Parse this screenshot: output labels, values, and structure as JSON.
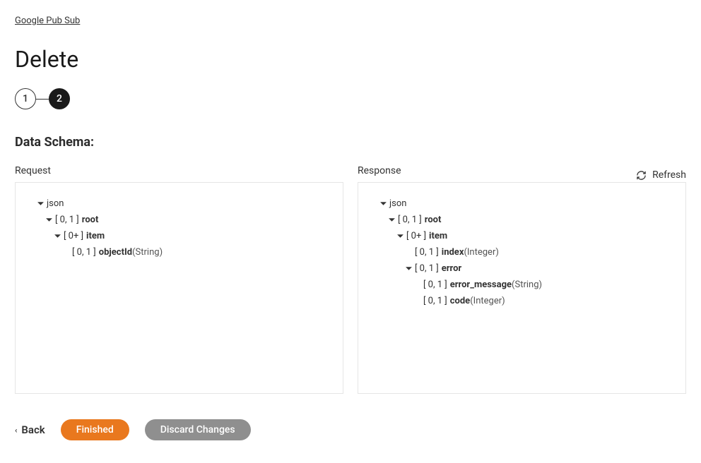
{
  "breadcrumb": "Google Pub Sub",
  "page_title": "Delete",
  "stepper": {
    "step1": "1",
    "step2": "2"
  },
  "schema_title": "Data Schema:",
  "refresh_label": "Refresh",
  "panels": {
    "request_label": "Request",
    "response_label": "Response"
  },
  "request_tree": {
    "json": "json",
    "root_card": "[ 0, 1 ]",
    "root_name": "root",
    "item_card": "[ 0+ ]",
    "item_name": "item",
    "objectId_card": "[ 0, 1 ]",
    "objectId_name": "objectId",
    "objectId_type": " (String)"
  },
  "response_tree": {
    "json": "json",
    "root_card": "[ 0, 1 ]",
    "root_name": "root",
    "item_card": "[ 0+ ]",
    "item_name": "item",
    "index_card": "[ 0, 1 ]",
    "index_name": "index",
    "index_type": " (Integer)",
    "error_card": "[ 0, 1 ]",
    "error_name": "error",
    "errmsg_card": "[ 0, 1 ]",
    "errmsg_name": "error_message",
    "errmsg_type": " (String)",
    "code_card": "[ 0, 1 ]",
    "code_name": "code",
    "code_type": " (Integer)"
  },
  "actions": {
    "back": "Back",
    "finished": "Finished",
    "discard": "Discard Changes"
  }
}
